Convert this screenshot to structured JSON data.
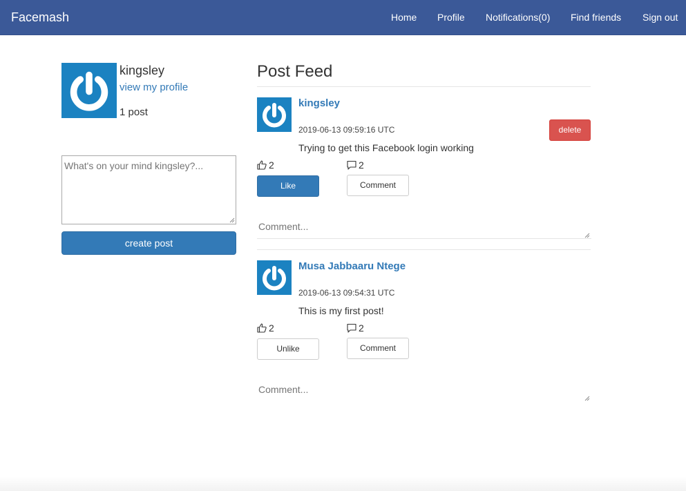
{
  "navbar": {
    "brand": "Facemash",
    "links": [
      "Home",
      "Profile",
      "Notifications(0)",
      "Find friends",
      "Sign out"
    ]
  },
  "sidebar": {
    "user_name": "kingsley",
    "profile_link": "view my profile",
    "post_count": "1 post",
    "post_placeholder": "What's on your mind kingsley?...",
    "create_button": "create post"
  },
  "feed": {
    "title": "Post Feed",
    "posts": [
      {
        "author": "kingsley",
        "timestamp": "2019-06-13 09:59:16 UTC",
        "content": "Trying to get this Facebook login working",
        "likes": "2",
        "comments": "2",
        "like_button": "Like",
        "comment_button": "Comment",
        "delete_button": "delete",
        "comment_placeholder": "Comment..."
      },
      {
        "author": "Musa Jabbaaru Ntege",
        "timestamp": "2019-06-13 09:54:31 UTC",
        "content": "This is my first post!",
        "likes": "2",
        "comments": "2",
        "like_button": "Unlike",
        "comment_button": "Comment",
        "comment_placeholder": "Comment..."
      }
    ]
  },
  "icons": {
    "avatar": "power-avatar-icon",
    "like": "thumbs-up-icon",
    "comment": "comment-bubble-icon"
  },
  "colors": {
    "navbar": "#3b5998",
    "primary": "#337ab7",
    "danger": "#d9534f",
    "avatar": "#1b82c1"
  }
}
